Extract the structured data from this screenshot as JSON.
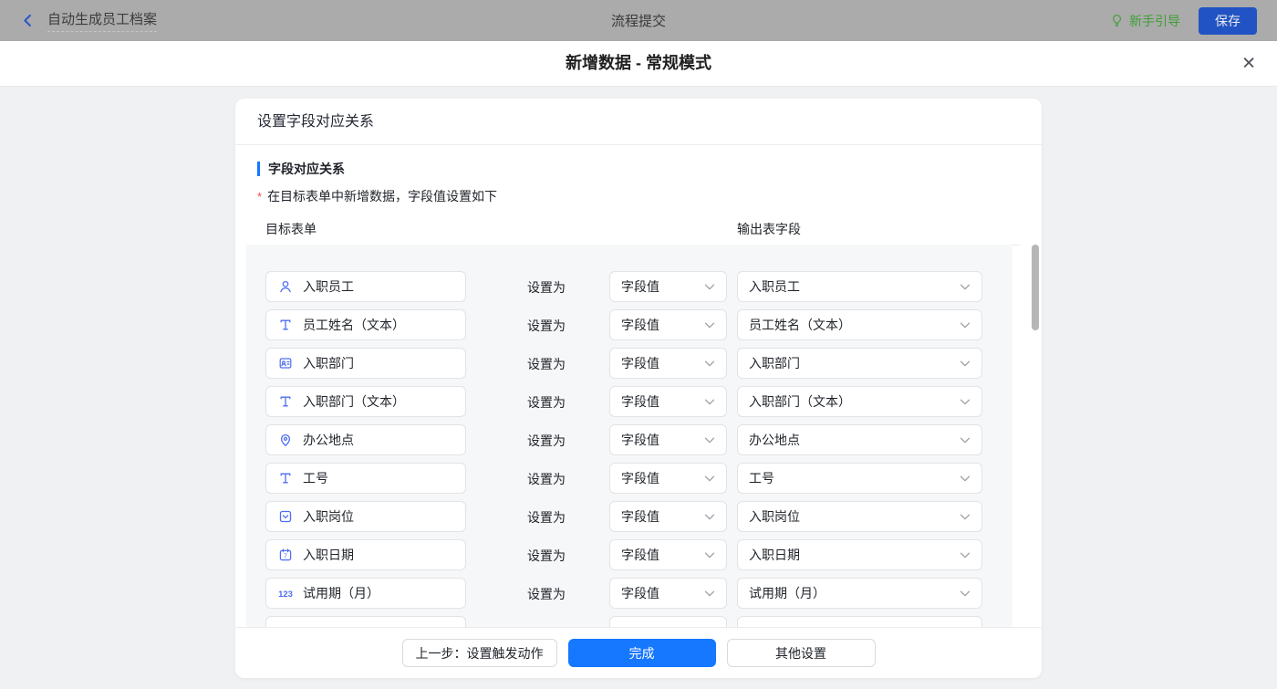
{
  "topbar": {
    "back_title": "自动生成员工档案",
    "center_title": "流程提交",
    "guide_label": "新手引导",
    "save_label": "保存"
  },
  "modal": {
    "title": "新增数据 - 常规模式",
    "close_glyph": "✕",
    "card_header": "设置字段对应关系",
    "section_title": "字段对应关系",
    "required_mark": "*",
    "section_desc": "在目标表单中新增数据，字段值设置如下",
    "columns": {
      "left": "目标表单",
      "right": "输出表字段"
    },
    "set_as_label": "设置为",
    "value_option": "字段值",
    "rows": [
      {
        "icon": "user-icon",
        "field": "入职员工",
        "output": "入职员工"
      },
      {
        "icon": "text-icon",
        "field": "员工姓名（文本）",
        "output": "员工姓名（文本）"
      },
      {
        "icon": "department-icon",
        "field": "入职部门",
        "output": "入职部门"
      },
      {
        "icon": "text-icon",
        "field": "入职部门（文本）",
        "output": "入职部门（文本）"
      },
      {
        "icon": "location-icon",
        "field": "办公地点",
        "output": "办公地点"
      },
      {
        "icon": "text-icon",
        "field": "工号",
        "output": "工号"
      },
      {
        "icon": "select-icon",
        "field": "入职岗位",
        "output": "入职岗位"
      },
      {
        "icon": "calendar-icon",
        "field": "入职日期",
        "output": "入职日期"
      },
      {
        "icon": "number-icon",
        "field": "试用期（月）",
        "output": "试用期（月）"
      }
    ],
    "footer": {
      "prev_label": "上一步：设置触发动作",
      "done_label": "完成",
      "other_label": "其他设置"
    }
  },
  "colors": {
    "primary_blue": "#1677ff",
    "icon_blue": "#4e6ef2",
    "guide_green": "#3f9e36",
    "save_button_blue": "#2153c4",
    "required_red": "#f54a45",
    "topbar_gray": "#ababab"
  }
}
